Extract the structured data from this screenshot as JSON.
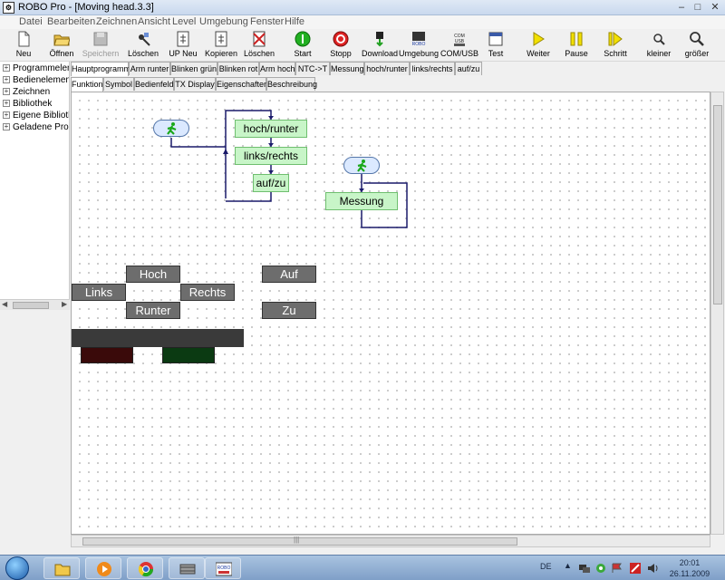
{
  "window": {
    "title": "ROBO Pro - [Moving head.3.3]",
    "min": "–",
    "max": "□",
    "close": "✕"
  },
  "menu": [
    "Datei",
    "Bearbeiten",
    "Zeichnen",
    "Ansicht",
    "Level",
    "Umgebung",
    "Fenster",
    "Hilfe"
  ],
  "toolbar": [
    {
      "label": "Neu",
      "icon": "new-file-icon"
    },
    {
      "label": "Öffnen",
      "icon": "folder-open-icon"
    },
    {
      "label": "Speichern",
      "icon": "save-disk-icon"
    },
    {
      "label": "Löschen",
      "icon": "delete-tools-icon"
    },
    {
      "label": "UP Neu",
      "icon": "subprogram-new-icon"
    },
    {
      "label": "Kopieren",
      "icon": "copy-icon"
    },
    {
      "label": "Löschen",
      "icon": "delete-x-icon"
    },
    {
      "label": "Start",
      "icon": "start-icon"
    },
    {
      "label": "Stopp",
      "icon": "stop-icon"
    },
    {
      "label": "Download",
      "icon": "download-icon"
    },
    {
      "label": "Umgebung",
      "icon": "environment-icon"
    },
    {
      "label": "COM/USB",
      "icon": "com-usb-icon"
    },
    {
      "label": "Test",
      "icon": "test-window-icon"
    },
    {
      "label": "Weiter",
      "icon": "play-icon"
    },
    {
      "label": "Pause",
      "icon": "pause-icon"
    },
    {
      "label": "Schritt",
      "icon": "step-icon"
    },
    {
      "label": "kleiner",
      "icon": "zoom-out-icon"
    },
    {
      "label": "größer",
      "icon": "zoom-in-icon"
    }
  ],
  "tree": [
    "Programmelemente",
    "Bedienelemente",
    "Zeichnen",
    "Bibliothek",
    "Eigene Bibliothek",
    "Geladene Programme"
  ],
  "program_tabs": [
    "Hauptprogramm",
    "Arm runter",
    "Blinken grün",
    "Blinken rot",
    "Arm hoch",
    "NTC->T",
    "Messung",
    "hoch/runter",
    "links/rechts",
    "auf/zu"
  ],
  "sub_tabs": [
    "Funktion",
    "Symbol",
    "Bedienfeld",
    "TX Display",
    "Eigenschaften",
    "Beschreibung"
  ],
  "flow": {
    "nodes": [
      "hoch/runter",
      "links/rechts",
      "auf/zu",
      "Messung"
    ]
  },
  "panel": {
    "buttons": [
      "Hoch",
      "Links",
      "Rechts",
      "Runter",
      "Auf",
      "Zu"
    ],
    "led_colors": [
      "#3a0a0a",
      "#0b3a12"
    ]
  },
  "taskbar": {
    "language": "DE",
    "time": "20:01",
    "date": "26.11.2009",
    "robo_logo": "ROBO"
  },
  "colors": {
    "accent_green": "#c8f5c8",
    "node_border": "#6fbf6f",
    "link_line": "#1a1a6a"
  }
}
